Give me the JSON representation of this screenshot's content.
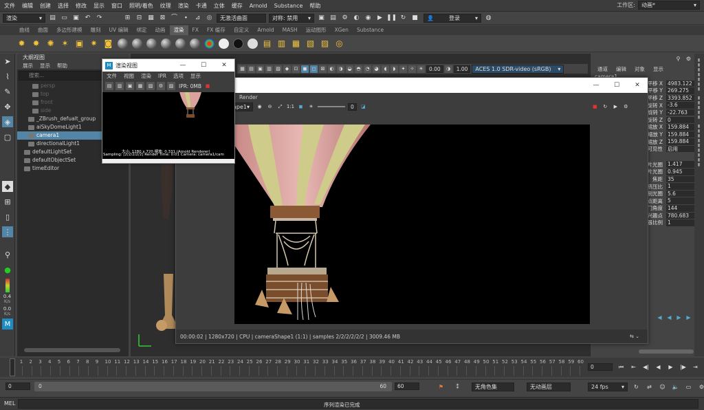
{
  "menubar": {
    "items": [
      "文件",
      "编辑",
      "创建",
      "选择",
      "修改",
      "显示",
      "窗口",
      "照明/着色",
      "纹理",
      "渲染",
      "卡通",
      "立体",
      "缓存",
      "Arnold",
      "Substance",
      "帮助"
    ],
    "workspace_label": "工作区:",
    "workspace_value": "动画*"
  },
  "statusline": {
    "mode_value": "渲染",
    "live_surface": "无激活曲面",
    "symmetry": "对称: 禁用",
    "login": "登录"
  },
  "shelf": {
    "tabs": [
      "曲线",
      "曲面",
      "多边形建模",
      "雕刻",
      "UV 编辑",
      "绑定",
      "动画",
      "渲染",
      "FX",
      "FX 缓存",
      "自定义",
      "Arnold",
      "MASH",
      "运动图形",
      "XGen",
      "Substance"
    ],
    "active_tab": "渲染"
  },
  "outliner": {
    "title": "大纲视图",
    "menu": [
      "展示",
      "显示",
      "帮助"
    ],
    "search_placeholder": "搜索...",
    "items": [
      {
        "label": "persp",
        "state": "dim"
      },
      {
        "label": "top",
        "state": "dim"
      },
      {
        "label": "front",
        "state": "dim"
      },
      {
        "label": "side",
        "state": "dim"
      },
      {
        "label": "_ZBrush_defualt_group",
        "state": "normal"
      },
      {
        "label": "aiSkyDomeLight1",
        "state": "normal"
      },
      {
        "label": "camera1",
        "state": "selected"
      },
      {
        "label": "directionalLight1",
        "state": "normal"
      },
      {
        "label": "defaultLightSet",
        "state": "normal"
      },
      {
        "label": "defaultObjectSet",
        "state": "normal"
      },
      {
        "label": "timeEditor",
        "state": "normal"
      }
    ]
  },
  "viewport_toolbar": {
    "value1": "0.00",
    "value2": "1.00",
    "colorspace": "ACES 1.0 SDR-video (sRGB)"
  },
  "channel_box": {
    "tabs": [
      "通道",
      "编辑",
      "对象",
      "显示"
    ],
    "node": "camera1",
    "attributes": [
      {
        "name": "平移 X",
        "value": "4983.122"
      },
      {
        "name": "平移 Y",
        "value": "269.275"
      },
      {
        "name": "平移 Z",
        "value": "3393.852"
      },
      {
        "name": "旋转 X",
        "value": "-3.6"
      },
      {
        "name": "旋转 Y",
        "value": "-22.763"
      },
      {
        "name": "旋转 Z",
        "value": "0"
      },
      {
        "name": "缩放 X",
        "value": "159.884"
      },
      {
        "name": "缩放 Y",
        "value": "159.884"
      },
      {
        "name": "缩放 Z",
        "value": "159.884"
      },
      {
        "name": "可见性",
        "value": "启用"
      }
    ],
    "shape_attributes": [
      {
        "name": "水平胶片光圈",
        "value": "1.417"
      },
      {
        "name": "垂直胶片光圈",
        "value": "0.945"
      },
      {
        "name": "焦距",
        "value": "35"
      },
      {
        "name": "镜头挤压比",
        "value": "1"
      },
      {
        "name": "F 制光圈",
        "value": "5.6"
      },
      {
        "name": "焦点距离",
        "value": "5"
      },
      {
        "name": "快门角度",
        "value": "144"
      },
      {
        "name": "中心兴趣点",
        "value": "780.683"
      },
      {
        "name": "定位器比例",
        "value": "1"
      }
    ]
  },
  "small_render_view": {
    "title": "渲染视图",
    "menu": [
      "文件",
      "视图",
      "渲染",
      "IPR",
      "选项",
      "显示"
    ],
    "ipr_label": "IPR: 0MB",
    "info_line1": "大小: 1280 x 720  缩放: 0.331    (Arnold Renderer)",
    "info_line2": "Sampling: [2/2/2/2/2]    Render Time: 0:01    Camera: camera1/cam"
  },
  "big_render_view": {
    "menu_render": "Render",
    "camera": "cameraShape1",
    "exposure": "0",
    "ratio": "1:1",
    "status": "00:00:02 | 1280x720 | CPU | cameraShape1 (1:1) | samples 2/2/2/2/2/2 | 3009.46 MB"
  },
  "timeline": {
    "current_frame": "0",
    "ticks": [
      "0",
      "1",
      "2",
      "3",
      "4",
      "5",
      "6",
      "7",
      "8",
      "9",
      "10",
      "11",
      "12",
      "13",
      "14",
      "15",
      "16",
      "17",
      "18",
      "19",
      "20",
      "21",
      "22",
      "23",
      "24",
      "25",
      "26",
      "27",
      "28",
      "29",
      "30",
      "31",
      "32",
      "33",
      "34",
      "35",
      "36",
      "37",
      "38",
      "39",
      "40",
      "41",
      "42",
      "43",
      "44",
      "45",
      "46",
      "47",
      "48",
      "49",
      "50",
      "51",
      "52",
      "53",
      "54",
      "55",
      "56",
      "57",
      "58",
      "59",
      "60"
    ]
  },
  "range": {
    "start": "0",
    "range_start": "0",
    "range_end": "60",
    "end": "60",
    "character_set": "无角色集",
    "anim_layer": "无动画层",
    "fps": "24 fps"
  },
  "left_stats": {
    "val1": "0.4",
    "unit1": "K/s",
    "val2": "0.0",
    "unit2": "K/s"
  },
  "cmdline": {
    "label": "MEL",
    "message": "序列渲染已完成"
  }
}
